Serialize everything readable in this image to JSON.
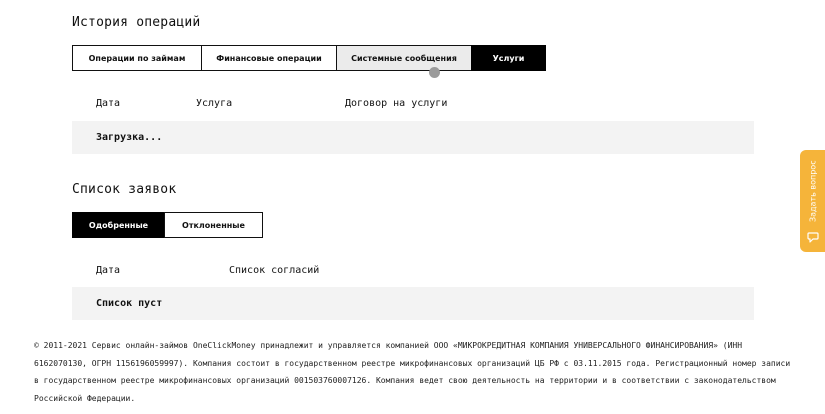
{
  "operations": {
    "title": "История операций",
    "tabs": [
      {
        "label": "Операции по займам"
      },
      {
        "label": "Финансовые операции"
      },
      {
        "label": "Системные сообщения"
      },
      {
        "label": "Услуги"
      }
    ],
    "columns": [
      "Дата",
      "Услуга",
      "Договор на услуги"
    ],
    "status": "Загрузка..."
  },
  "requests": {
    "title": "Список заявок",
    "tabs": [
      {
        "label": "Одобренные"
      },
      {
        "label": "Отклоненные"
      }
    ],
    "columns": [
      "Дата",
      "Список согласий"
    ],
    "status": "Список пуст"
  },
  "footer": {
    "text": "© 2011-2021 Сервис онлайн-займов OneClickMoney принадлежит и управляется компанией ООО «МИКРОКРЕДИТНАЯ КОМПАНИЯ УНИВЕРСАЛЬНОГО ФИНАНСИРОВАНИЯ» (ИНН 6162070130, ОГРН 1156196059997). Компания состоит в государственном реестре микрофинансовых организаций ЦБ РФ с 03.11.2015 года. Регистрационный номер записи в государственном реестре микрофинансовых организаций 001503760007126. Компания ведет свою деятельность на территории и в соответствии с законодательством Российской Федерации."
  },
  "ask_widget": {
    "label": "Задать вопрос",
    "icon": "chat-bubble-icon",
    "color": "#f5b43a"
  },
  "colors": {
    "active_tab": "#000000",
    "hover_tab": "#ebebeb",
    "table_row_bg": "#f3f3f3"
  }
}
